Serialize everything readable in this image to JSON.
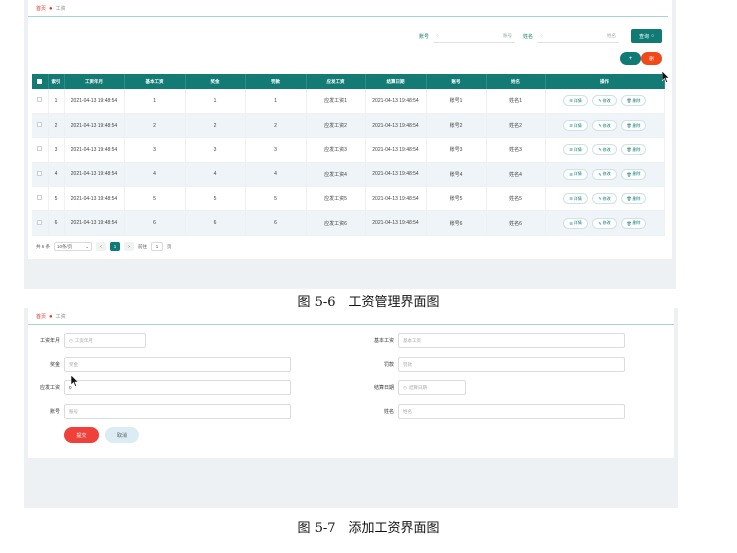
{
  "figure1": {
    "breadcrumb": {
      "home": "首页",
      "current": "工资"
    },
    "search": [
      {
        "label": "账号",
        "placeholder": "账号"
      },
      {
        "label": "姓名",
        "placeholder": "姓名"
      }
    ],
    "query_label": "查询",
    "add_label": "+",
    "delete_label": "删",
    "columns": [
      "",
      "索引",
      "工资年月",
      "基本工资",
      "奖金",
      "罚款",
      "应发工资",
      "结算日期",
      "账号",
      "姓名",
      "操作"
    ],
    "rows": [
      {
        "index": "1",
        "month": "2021-04-13 19:48:54",
        "base": "1",
        "bonus": "1",
        "fine": "1",
        "payable": "应发工资1",
        "settle": "2021-04-13 19:48:54",
        "account": "账号1",
        "name": "姓名1"
      },
      {
        "index": "2",
        "month": "2021-04-13 19:48:54",
        "base": "2",
        "bonus": "2",
        "fine": "2",
        "payable": "应发工资2",
        "settle": "2021-04-13 19:48:54",
        "account": "账号2",
        "name": "姓名2"
      },
      {
        "index": "3",
        "month": "2021-04-13 19:48:54",
        "base": "3",
        "bonus": "3",
        "fine": "3",
        "payable": "应发工资3",
        "settle": "2021-04-13 19:48:54",
        "account": "账号3",
        "name": "姓名3"
      },
      {
        "index": "4",
        "month": "2021-04-13 19:48:54",
        "base": "4",
        "bonus": "4",
        "fine": "4",
        "payable": "应发工资4",
        "settle": "2021-04-13 19:48:54",
        "account": "账号4",
        "name": "姓名4"
      },
      {
        "index": "5",
        "month": "2021-04-13 19:48:54",
        "base": "5",
        "bonus": "5",
        "fine": "5",
        "payable": "应发工资5",
        "settle": "2021-04-13 19:48:54",
        "account": "账号5",
        "name": "姓名5"
      },
      {
        "index": "6",
        "month": "2021-04-13 19:48:54",
        "base": "6",
        "bonus": "6",
        "fine": "6",
        "payable": "应发工资6",
        "settle": "2021-04-13 19:48:54",
        "account": "账号6",
        "name": "姓名6"
      }
    ],
    "ops": {
      "detail": "详情",
      "edit": "修改",
      "delete": "删除"
    },
    "pager": {
      "total": "共 6 条",
      "page_size": "10条/页",
      "prev": "<",
      "page": "1",
      "next": ">",
      "goto": "前往",
      "goto_value": "1",
      "unit": "页"
    }
  },
  "caption1": "图 5-6　工资管理界面图",
  "figure2": {
    "breadcrumb": {
      "home": "首页",
      "current": "工资"
    },
    "fields": {
      "month": {
        "label": "工资年月",
        "placeholder": "工资年月"
      },
      "base": {
        "label": "基本工资",
        "placeholder": "基本工资"
      },
      "bonus": {
        "label": "奖金",
        "placeholder": "奖金"
      },
      "fine": {
        "label": "罚款",
        "placeholder": "罚款"
      },
      "payable": {
        "label": "应发工资",
        "value": "0"
      },
      "settle": {
        "label": "结算日期",
        "placeholder": "结算日期"
      },
      "account": {
        "label": "账号",
        "placeholder": "账号"
      },
      "name": {
        "label": "姓名",
        "placeholder": "姓名"
      }
    },
    "submit_label": "提交",
    "cancel_label": "取消"
  },
  "caption2": "图 5-7　添加工资界面图",
  "colors": {
    "primary": "#137a74",
    "danger": "#f04a1a",
    "accent_red": "#d9382d"
  },
  "icons": [
    "search-icon",
    "calendar-icon",
    "detail-icon",
    "edit-icon",
    "delete-icon",
    "mouse-cursor-icon"
  ]
}
